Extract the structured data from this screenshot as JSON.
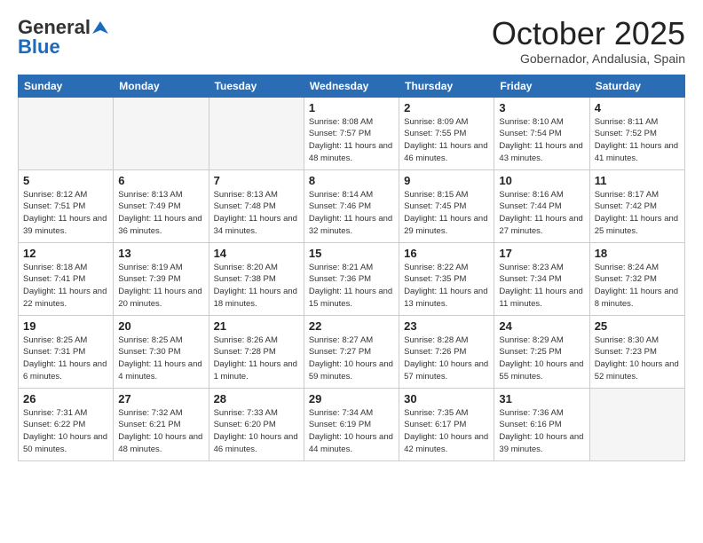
{
  "logo": {
    "general": "General",
    "blue": "Blue"
  },
  "header": {
    "month": "October 2025",
    "location": "Gobernador, Andalusia, Spain"
  },
  "weekdays": [
    "Sunday",
    "Monday",
    "Tuesday",
    "Wednesday",
    "Thursday",
    "Friday",
    "Saturday"
  ],
  "weeks": [
    [
      {
        "day": "",
        "info": ""
      },
      {
        "day": "",
        "info": ""
      },
      {
        "day": "",
        "info": ""
      },
      {
        "day": "1",
        "info": "Sunrise: 8:08 AM\nSunset: 7:57 PM\nDaylight: 11 hours\nand 48 minutes."
      },
      {
        "day": "2",
        "info": "Sunrise: 8:09 AM\nSunset: 7:55 PM\nDaylight: 11 hours\nand 46 minutes."
      },
      {
        "day": "3",
        "info": "Sunrise: 8:10 AM\nSunset: 7:54 PM\nDaylight: 11 hours\nand 43 minutes."
      },
      {
        "day": "4",
        "info": "Sunrise: 8:11 AM\nSunset: 7:52 PM\nDaylight: 11 hours\nand 41 minutes."
      }
    ],
    [
      {
        "day": "5",
        "info": "Sunrise: 8:12 AM\nSunset: 7:51 PM\nDaylight: 11 hours\nand 39 minutes."
      },
      {
        "day": "6",
        "info": "Sunrise: 8:13 AM\nSunset: 7:49 PM\nDaylight: 11 hours\nand 36 minutes."
      },
      {
        "day": "7",
        "info": "Sunrise: 8:13 AM\nSunset: 7:48 PM\nDaylight: 11 hours\nand 34 minutes."
      },
      {
        "day": "8",
        "info": "Sunrise: 8:14 AM\nSunset: 7:46 PM\nDaylight: 11 hours\nand 32 minutes."
      },
      {
        "day": "9",
        "info": "Sunrise: 8:15 AM\nSunset: 7:45 PM\nDaylight: 11 hours\nand 29 minutes."
      },
      {
        "day": "10",
        "info": "Sunrise: 8:16 AM\nSunset: 7:44 PM\nDaylight: 11 hours\nand 27 minutes."
      },
      {
        "day": "11",
        "info": "Sunrise: 8:17 AM\nSunset: 7:42 PM\nDaylight: 11 hours\nand 25 minutes."
      }
    ],
    [
      {
        "day": "12",
        "info": "Sunrise: 8:18 AM\nSunset: 7:41 PM\nDaylight: 11 hours\nand 22 minutes."
      },
      {
        "day": "13",
        "info": "Sunrise: 8:19 AM\nSunset: 7:39 PM\nDaylight: 11 hours\nand 20 minutes."
      },
      {
        "day": "14",
        "info": "Sunrise: 8:20 AM\nSunset: 7:38 PM\nDaylight: 11 hours\nand 18 minutes."
      },
      {
        "day": "15",
        "info": "Sunrise: 8:21 AM\nSunset: 7:36 PM\nDaylight: 11 hours\nand 15 minutes."
      },
      {
        "day": "16",
        "info": "Sunrise: 8:22 AM\nSunset: 7:35 PM\nDaylight: 11 hours\nand 13 minutes."
      },
      {
        "day": "17",
        "info": "Sunrise: 8:23 AM\nSunset: 7:34 PM\nDaylight: 11 hours\nand 11 minutes."
      },
      {
        "day": "18",
        "info": "Sunrise: 8:24 AM\nSunset: 7:32 PM\nDaylight: 11 hours\nand 8 minutes."
      }
    ],
    [
      {
        "day": "19",
        "info": "Sunrise: 8:25 AM\nSunset: 7:31 PM\nDaylight: 11 hours\nand 6 minutes."
      },
      {
        "day": "20",
        "info": "Sunrise: 8:25 AM\nSunset: 7:30 PM\nDaylight: 11 hours\nand 4 minutes."
      },
      {
        "day": "21",
        "info": "Sunrise: 8:26 AM\nSunset: 7:28 PM\nDaylight: 11 hours\nand 1 minute."
      },
      {
        "day": "22",
        "info": "Sunrise: 8:27 AM\nSunset: 7:27 PM\nDaylight: 10 hours\nand 59 minutes."
      },
      {
        "day": "23",
        "info": "Sunrise: 8:28 AM\nSunset: 7:26 PM\nDaylight: 10 hours\nand 57 minutes."
      },
      {
        "day": "24",
        "info": "Sunrise: 8:29 AM\nSunset: 7:25 PM\nDaylight: 10 hours\nand 55 minutes."
      },
      {
        "day": "25",
        "info": "Sunrise: 8:30 AM\nSunset: 7:23 PM\nDaylight: 10 hours\nand 52 minutes."
      }
    ],
    [
      {
        "day": "26",
        "info": "Sunrise: 7:31 AM\nSunset: 6:22 PM\nDaylight: 10 hours\nand 50 minutes."
      },
      {
        "day": "27",
        "info": "Sunrise: 7:32 AM\nSunset: 6:21 PM\nDaylight: 10 hours\nand 48 minutes."
      },
      {
        "day": "28",
        "info": "Sunrise: 7:33 AM\nSunset: 6:20 PM\nDaylight: 10 hours\nand 46 minutes."
      },
      {
        "day": "29",
        "info": "Sunrise: 7:34 AM\nSunset: 6:19 PM\nDaylight: 10 hours\nand 44 minutes."
      },
      {
        "day": "30",
        "info": "Sunrise: 7:35 AM\nSunset: 6:17 PM\nDaylight: 10 hours\nand 42 minutes."
      },
      {
        "day": "31",
        "info": "Sunrise: 7:36 AM\nSunset: 6:16 PM\nDaylight: 10 hours\nand 39 minutes."
      },
      {
        "day": "",
        "info": ""
      }
    ]
  ]
}
